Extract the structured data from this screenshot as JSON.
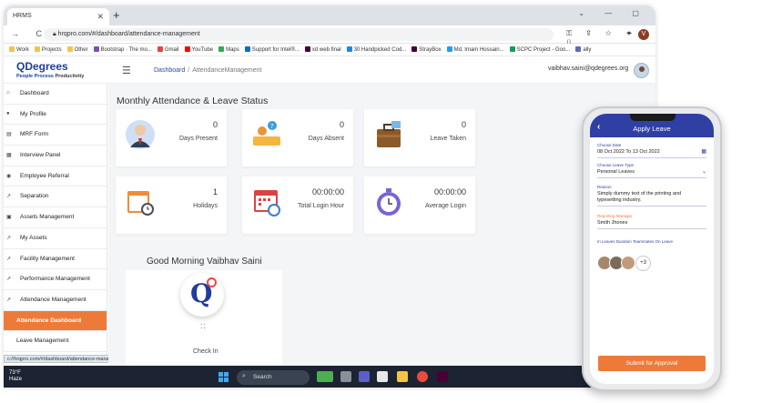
{
  "browser": {
    "tab_title": "HRMS",
    "url": "hrqpro.com/#/dashboard/attendance-management",
    "profile_initial": "V",
    "bookmarks": [
      {
        "label": "Work",
        "color": "#f4c542"
      },
      {
        "label": "Projects",
        "color": "#f4c542"
      },
      {
        "label": "Other",
        "color": "#f4c542"
      },
      {
        "label": "Bootstrap · The mo...",
        "color": "#7952b3"
      },
      {
        "label": "Gmail",
        "color": "#ea4335"
      },
      {
        "label": "YouTube",
        "color": "#ff0000"
      },
      {
        "label": "Maps",
        "color": "#34a853"
      },
      {
        "label": "Support for Intel®...",
        "color": "#0071c5"
      },
      {
        "label": "xd web final",
        "color": "#470137"
      },
      {
        "label": "30 Handpicked Cod...",
        "color": "#1e88e5"
      },
      {
        "label": "StrayBox",
        "color": "#470137"
      },
      {
        "label": "Md. Imam Hossain...",
        "color": "#1da1f2"
      },
      {
        "label": "SCPC Project - Goo...",
        "color": "#0f9d58"
      },
      {
        "label": "ally",
        "color": "#5c6bc0"
      }
    ]
  },
  "app": {
    "logo_main": "QDegrees",
    "logo_tag_1": "People ",
    "logo_tag_2": "Process ",
    "logo_tag_3": "Productivity",
    "breadcrumb_home": "Dashboard",
    "breadcrumb_sep": "/",
    "breadcrumb_current": "AttendanceManagement",
    "user_email": "vaibhav.saini@qdegrees.org"
  },
  "sidebar": {
    "items": [
      {
        "label": "Dashboard",
        "icon": "home-icon",
        "glyph": "⌂"
      },
      {
        "label": "My Profile",
        "icon": "user-icon",
        "glyph": "●"
      },
      {
        "label": "MRF Form",
        "icon": "form-icon",
        "glyph": "▤"
      },
      {
        "label": "Interview Panel",
        "icon": "panel-icon",
        "glyph": "▦"
      },
      {
        "label": "Employee Referral",
        "icon": "referral-icon",
        "glyph": "◉"
      },
      {
        "label": "Separation",
        "icon": "separation-icon",
        "glyph": "↗"
      },
      {
        "label": "Assets Management",
        "icon": "assets-icon",
        "glyph": "▣"
      },
      {
        "label": "My Assets",
        "icon": "my-assets-icon",
        "glyph": "↗"
      },
      {
        "label": "Facility Management",
        "icon": "facility-icon",
        "glyph": "↗"
      },
      {
        "label": "Performance Management",
        "icon": "performance-icon",
        "glyph": "↗"
      },
      {
        "label": "Attendance Management",
        "icon": "attendance-icon",
        "glyph": "↗"
      }
    ],
    "sub_items": [
      {
        "label": "Attendance Dashboard",
        "active": true
      },
      {
        "label": "Leave Management",
        "active": false
      }
    ],
    "status_url": "c://hrqpro.com/#/dashboard/attendance-management"
  },
  "main": {
    "title": "Monthly Attendance & Leave Status",
    "cards": [
      {
        "value": "0",
        "label": "Days Present",
        "icon": "person-icon"
      },
      {
        "value": "0",
        "label": "Days Absent",
        "icon": "absent-icon"
      },
      {
        "value": "0",
        "label": "Leave Taken",
        "icon": "briefcase-icon"
      },
      {
        "value": "1",
        "label": "Holidays",
        "icon": "calendar-clock-icon"
      },
      {
        "value": "00:00:00",
        "label": "Total Login Hour",
        "icon": "calendar-time-icon"
      },
      {
        "value": "00:00:00",
        "label": "Average Login",
        "icon": "stopwatch-icon"
      }
    ],
    "greeting": "Good Morning Vaibhav Saini",
    "check_in_label": "Check In",
    "handle_glyph": "⁚⁚"
  },
  "taskbar": {
    "temperature": "73°F",
    "weather": "Haze",
    "search_label": "Search"
  },
  "phone": {
    "title": "Apply Leave",
    "date_label": "Choose Date",
    "date_value": "08 Oct 2022 To 13 Oct 2022",
    "type_label": "Choose Leave Type",
    "type_value": "Personal Leaves",
    "reason_label": "Reason",
    "reason_value": "Simply dummy text of the printing and typesetting industry.",
    "manager_label": "Reporting Manager",
    "manager_value": "Smith Jhones",
    "team_label": "In Leaves Duration Teammates On Leave",
    "more_count": "+3",
    "submit_label": "Submit for Approval"
  },
  "colors": {
    "brand_blue": "#2f3fa4",
    "accent_orange": "#ee7a3a",
    "logo_red": "#e8484c"
  }
}
